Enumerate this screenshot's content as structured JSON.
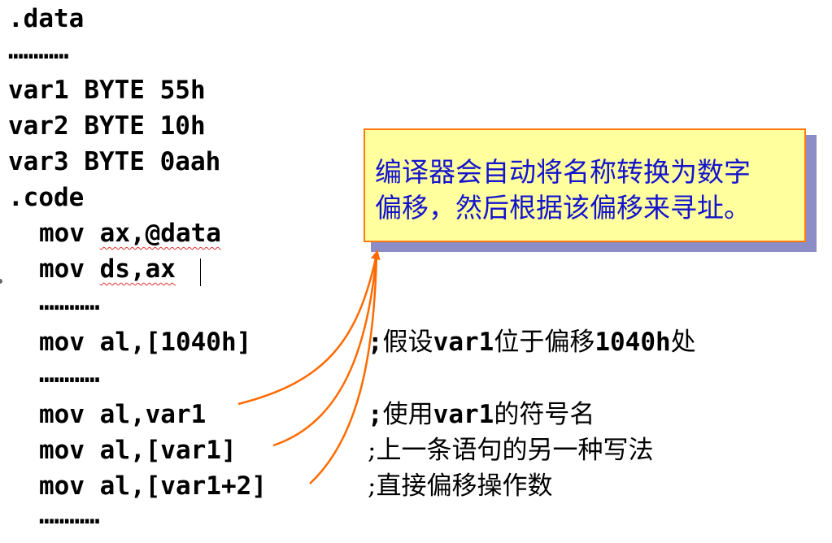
{
  "code": {
    "data_directive": ".data",
    "dots": "…………",
    "var1": "var1 BYTE 55h",
    "var2": "var2 BYTE 10h",
    "var3": "var3 BYTE 0aah",
    "code_directive": ".code",
    "mov1_op": "mov ",
    "mov1_args": "ax,@data",
    "mov2_op": "mov ",
    "mov2_args": "ds,ax",
    "line_1040": "mov al,[1040h]",
    "line_var1": "mov al,var1",
    "line_bracket": "mov al,[var1]",
    "line_plus2": "mov al,[var1+2]"
  },
  "comments": {
    "c1_semicolon": ";",
    "c1_a": "假设",
    "c1_b": "var1",
    "c1_c": "位于偏移",
    "c1_d": "1040h",
    "c1_e": "处",
    "c2_semicolon": ";",
    "c2_a": "使用",
    "c2_b": "var1",
    "c2_c": "的符号名",
    "c3": ";上一条语句的另一种写法",
    "c4": ";直接偏移操作数"
  },
  "callout": {
    "line1": "编译器会自动将名称转换为数字",
    "line2": "偏移，然后根据该偏移来寻址。"
  },
  "colors": {
    "callout_bg": "#ffff9e",
    "callout_border": "#ff7a10",
    "callout_text": "#1414cc",
    "arrow": "#ff6a00"
  }
}
